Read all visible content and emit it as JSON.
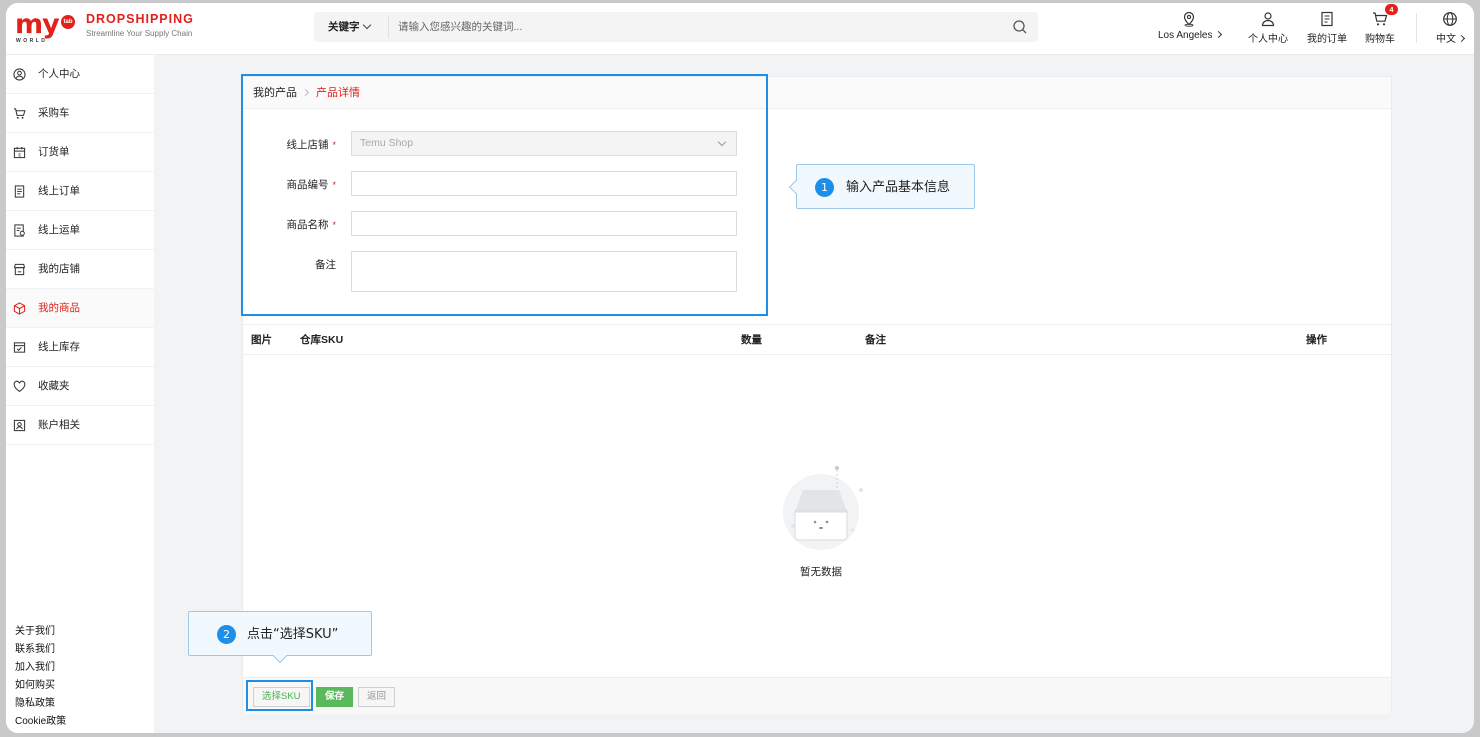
{
  "header": {
    "logo_text": "my",
    "logo_badge": "tab",
    "logo_sub": "WORLD",
    "brand_title": "DROPSHIPPING",
    "brand_subtitle": "Streamline Your Supply Chain",
    "search_type": "关键字",
    "search_placeholder": "请输入您感兴趣的关键词...",
    "location": "Los Angeles",
    "account": "个人中心",
    "orders": "我的订单",
    "cart": "购物车",
    "cart_count": "4",
    "language": "中文"
  },
  "sidebar": {
    "items": [
      {
        "label": "个人中心",
        "icon": "user-circle-icon",
        "active": false
      },
      {
        "label": "采购车",
        "icon": "cart-icon",
        "active": false
      },
      {
        "label": "订货单",
        "icon": "calendar-icon",
        "active": false
      },
      {
        "label": "线上订单",
        "icon": "document-icon",
        "active": false
      },
      {
        "label": "线上运单",
        "icon": "waybill-icon",
        "active": false
      },
      {
        "label": "我的店铺",
        "icon": "store-icon",
        "active": false
      },
      {
        "label": "我的商品",
        "icon": "box-icon",
        "active": true
      },
      {
        "label": "线上库存",
        "icon": "inventory-icon",
        "active": false
      },
      {
        "label": "收藏夹",
        "icon": "heart-icon",
        "active": false
      },
      {
        "label": "账户相关",
        "icon": "account-icon",
        "active": false
      }
    ],
    "footer_links": [
      "关于我们",
      "联系我们",
      "加入我们",
      "如何购买",
      "隐私政策",
      "Cookie政策"
    ]
  },
  "breadcrumb": {
    "parent": "我的产品",
    "current": "产品详情"
  },
  "form": {
    "store_label": "线上店铺",
    "store_value": "Temu Shop",
    "code_label": "商品编号",
    "code_value": "",
    "name_label": "商品名称",
    "name_value": "",
    "remark_label": "备注",
    "remark_value": "",
    "required_mark": "*"
  },
  "table": {
    "columns": [
      "图片",
      "仓库SKU",
      "数量",
      "备注",
      "操作"
    ],
    "empty_text": "暂无数据"
  },
  "buttons": {
    "select_sku": "选择SKU",
    "save": "保存",
    "back": "返回"
  },
  "annotations": [
    {
      "number": "1",
      "text": "输入产品基本信息"
    },
    {
      "number": "2",
      "text": "点击“选择SKU”"
    }
  ],
  "colors": {
    "brand_red": "#e2211c",
    "highlight_blue": "#1e8fe8",
    "save_green": "#5cb85c"
  }
}
